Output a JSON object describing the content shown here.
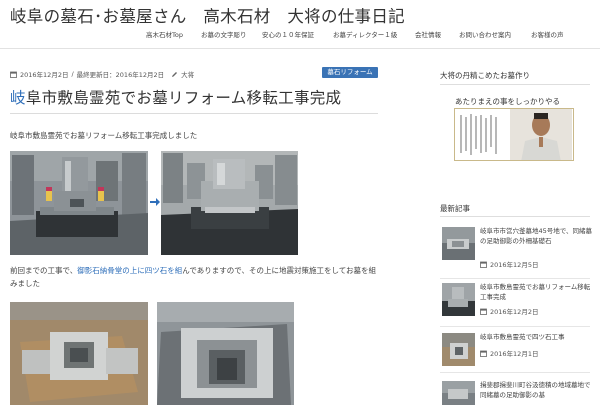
{
  "site": {
    "title": "岐阜の墓石･お墓屋さん　高木石材　大将の仕事日記"
  },
  "nav": {
    "items": [
      "高木石材Top",
      "お墓の文字彫り",
      "安心の１０年保証",
      "お墓ディレクター１級",
      "会社情報",
      "お問い合わせ案内",
      "お客様の声"
    ]
  },
  "post": {
    "date": "2016年12月2日",
    "updated": "最終更新日：2016年12月2日",
    "author": "大将",
    "category": "墓石リフォーム",
    "title_first": "岐",
    "title_rest": "阜市敷島霊苑でお墓リフォーム移転工事完成",
    "intro": "岐阜市敷島霊苑でお墓リフォーム移転工事完成しました",
    "para2_before": "前回までの工事で、",
    "para2_link": "御影石納骨堂の上に四ツ石を組",
    "para2_after": "んでありますので、その上に地震対策施工をしてお墓を組みました"
  },
  "sidebar": {
    "profile_heading": "大将の丹精こめたお墓作り",
    "profile_caption": "あたりまえの事をしっかりやる",
    "recent_heading": "最新記事",
    "recent": [
      {
        "title": "岐阜市市営穴釜墓地45号地で、同緒墓の足助御影の外柵基礎石",
        "date": "2016年12月5日"
      },
      {
        "title": "岐阜市敷島霊苑でお墓リフォーム移転工事完成",
        "date": "2016年12月2日"
      },
      {
        "title": "岐阜市敷島霊苑で四ツ石工事",
        "date": "2016年12月1日"
      },
      {
        "title": "揖斐郡揖斐川町谷汲徳積の地域墓地で同緒墓の足助御影の基",
        "date": ""
      }
    ]
  },
  "colors": {
    "accent": "#2f6fba",
    "badge": "#3a73b5",
    "profile_border": "#c9b98a"
  },
  "icons": [
    "calendar-icon",
    "refresh-icon",
    "pencil-icon",
    "arrow-right-icon"
  ]
}
